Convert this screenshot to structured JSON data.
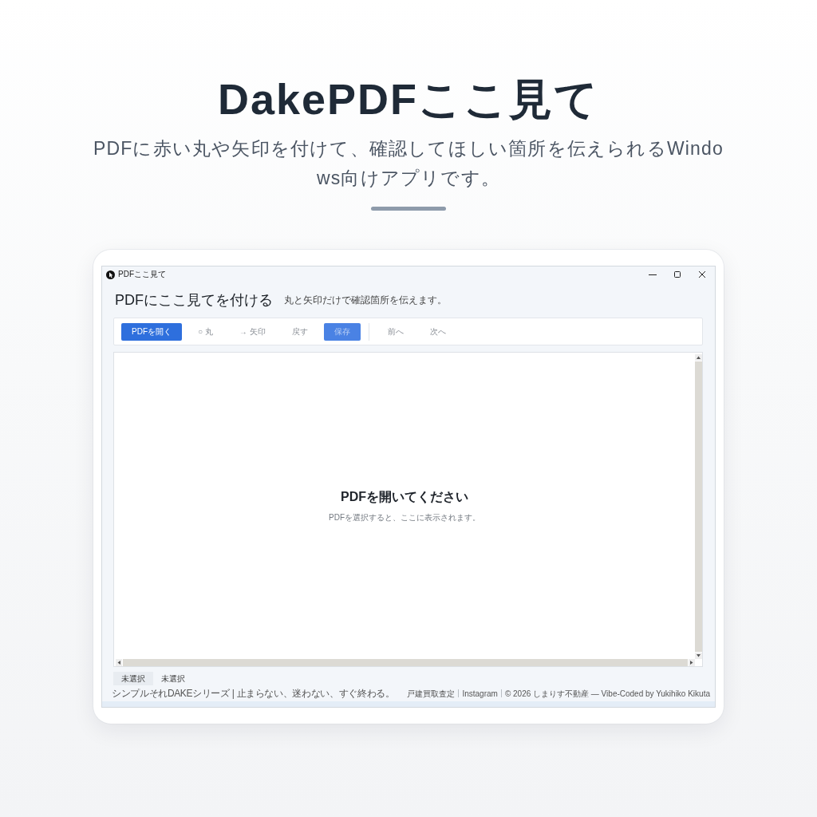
{
  "hero": {
    "title": "DakePDFここ見て",
    "subtitle": "PDFに赤い丸や矢印を付けて、確認してほしい箇所を伝えられるWindows向けアプリです。"
  },
  "app_window": {
    "title": "PDFここ見て",
    "header": {
      "title": "PDFにここ見てを付ける",
      "subtitle": "丸と矢印だけで確認箇所を伝えます。"
    },
    "toolbar": [
      {
        "label": "PDFを開く",
        "kind": "primary",
        "disabled": false
      },
      {
        "label": "○ 丸",
        "kind": "plain",
        "disabled": true
      },
      {
        "label": "→ 矢印",
        "kind": "plain",
        "disabled": true
      },
      {
        "label": "戻す",
        "kind": "plain",
        "disabled": true
      },
      {
        "label": "保存",
        "kind": "primary",
        "disabled": true
      },
      {
        "kind": "separator"
      },
      {
        "label": "前へ",
        "kind": "plain",
        "disabled": true
      },
      {
        "label": "次へ",
        "kind": "plain",
        "disabled": true
      }
    ],
    "viewer": {
      "empty_title": "PDFを開いてください",
      "empty_hint": "PDFを選択すると、ここに表示されます。"
    },
    "status": [
      {
        "text": "未選択",
        "kind": "chip"
      },
      {
        "text": "未選択",
        "kind": "plain"
      }
    ],
    "footer": {
      "tagline": "シンプルそれDAKEシリーズ | 止まらない、迷わない、すぐ終わる。",
      "links": [
        "戸建買取査定",
        "Instagram"
      ],
      "credit": "© 2026 しまりす不動産 — Vibe-Coded by Yukihiko Kikuta"
    }
  }
}
